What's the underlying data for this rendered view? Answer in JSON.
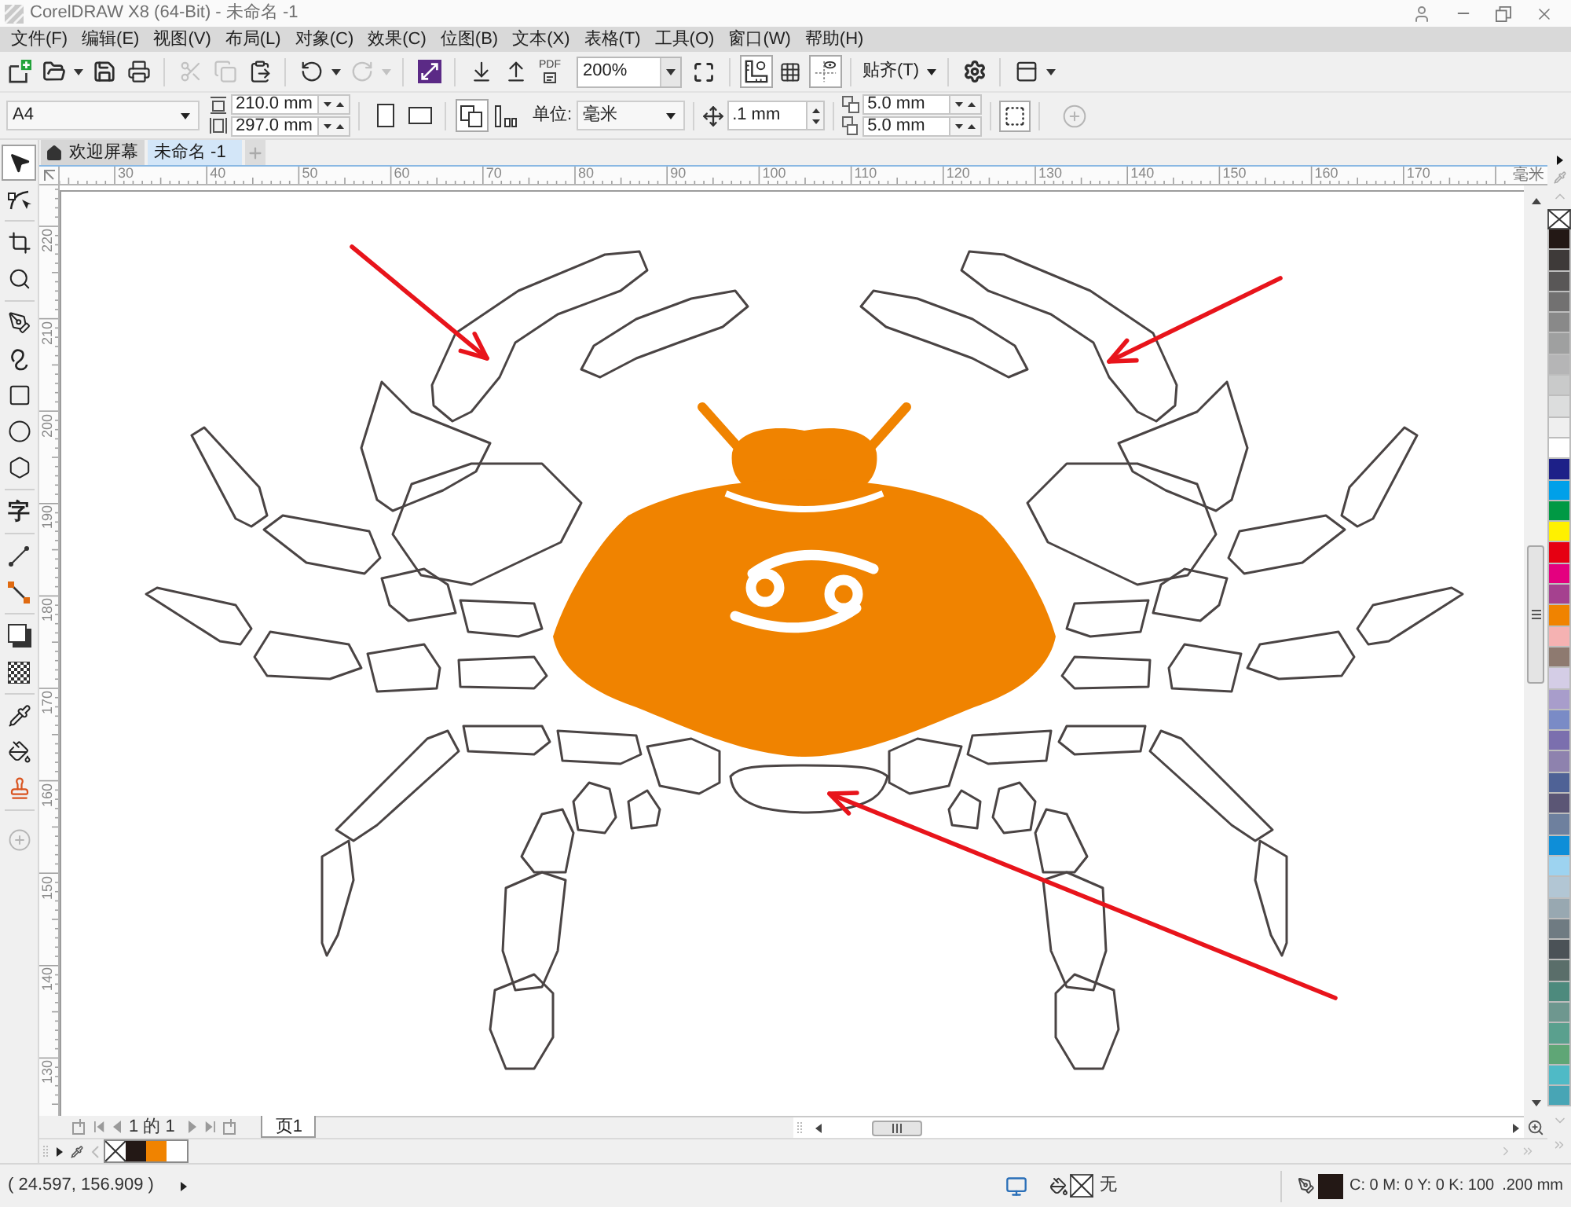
{
  "window": {
    "title": "CorelDRAW X8 (64-Bit) - 未命名 -1"
  },
  "menu": [
    "文件(F)",
    "编辑(E)",
    "视图(V)",
    "布局(L)",
    "对象(C)",
    "效果(C)",
    "位图(B)",
    "文本(X)",
    "表格(T)",
    "工具(O)",
    "窗口(W)",
    "帮助(H)"
  ],
  "standard_toolbar": {
    "buttons": [
      {
        "kind": "new",
        "disabled": false
      },
      {
        "kind": "open",
        "disabled": false
      },
      {
        "kind": "save",
        "disabled": false
      },
      {
        "kind": "print",
        "disabled": false
      },
      {
        "kind": "cut",
        "disabled": true
      },
      {
        "kind": "copy",
        "disabled": true
      },
      {
        "kind": "paste",
        "disabled": false
      },
      {
        "kind": "undo",
        "disabled": false
      },
      {
        "kind": "redo",
        "disabled": true
      },
      {
        "kind": "launcher",
        "disabled": false
      },
      {
        "kind": "import",
        "disabled": false
      },
      {
        "kind": "export",
        "disabled": false
      },
      {
        "kind": "publish_pdf",
        "disabled": false,
        "label": "PDF"
      }
    ],
    "zoom": "200%",
    "view_toggles": [
      {
        "kind": "rulers",
        "on": true
      },
      {
        "kind": "grid",
        "on": false
      },
      {
        "kind": "guidelines",
        "on": true
      }
    ],
    "snap": "贴齐(T)"
  },
  "property_bar": {
    "page_size": "A4",
    "width": "210.0 mm",
    "height": "297.0 mm",
    "page_layout_buttons": [
      {
        "kind": "all_pages",
        "selected": true
      },
      {
        "kind": "current_page",
        "selected": false
      }
    ],
    "units_label": "单位:",
    "units": "毫米",
    "nudge": ".1 mm",
    "duplicate_x": "5.0 mm",
    "duplicate_y": "5.0 mm"
  },
  "toolbox": [
    {
      "kind": "pick",
      "selected": true
    },
    {
      "kind": "shape",
      "selected": false
    },
    {
      "kind": "crop",
      "selected": false
    },
    {
      "kind": "zoom",
      "selected": false
    },
    {
      "kind": "freehand",
      "selected": false
    },
    {
      "kind": "artistic_media",
      "selected": false
    },
    {
      "kind": "rectangle",
      "selected": false
    },
    {
      "kind": "ellipse",
      "selected": false
    },
    {
      "kind": "polygon",
      "selected": false
    },
    {
      "kind": "text",
      "label": "字",
      "selected": false
    },
    {
      "kind": "dimension",
      "selected": false
    },
    {
      "kind": "connector",
      "selected": false
    },
    {
      "kind": "drop_shadow",
      "selected": false
    },
    {
      "kind": "transparency",
      "selected": false
    },
    {
      "kind": "eyedropper",
      "selected": false
    },
    {
      "kind": "interactive_fill",
      "selected": false
    },
    {
      "kind": "smart_fill",
      "selected": false
    }
  ],
  "document_tabs": [
    {
      "kind": "home",
      "label": "欢迎屏幕",
      "selected": false
    },
    {
      "kind": "document",
      "label": "未命名 -1",
      "selected": true
    }
  ],
  "rulers": {
    "unit": "毫米",
    "horizontal": [
      "30",
      "40",
      "50",
      "60",
      "70",
      "80",
      "90",
      "100",
      "110",
      "120",
      "130",
      "140",
      "150",
      "160",
      "170"
    ],
    "vertical": [
      "220",
      "210",
      "200",
      "190",
      "180",
      "170",
      "160",
      "150",
      "140",
      "130"
    ]
  },
  "page_navigation": {
    "position": "1 的 1",
    "pages": [
      {
        "label": "页1",
        "selected": true
      }
    ]
  },
  "document_palette": [
    {
      "color": "#231815"
    },
    {
      "color": "#f08300"
    },
    {
      "color": "#ffffff"
    }
  ],
  "color_palette": [
    {
      "color": "#231815"
    },
    {
      "color": "#3e3a39"
    },
    {
      "color": "#595757"
    },
    {
      "color": "#727171"
    },
    {
      "color": "#898989"
    },
    {
      "color": "#9fa0a0"
    },
    {
      "color": "#b5b5b6"
    },
    {
      "color": "#c9caca"
    },
    {
      "color": "#dcdddd"
    },
    {
      "color": "#efefef"
    },
    {
      "color": "#ffffff"
    },
    {
      "color": "#1d2088"
    },
    {
      "color": "#00a0e9"
    },
    {
      "color": "#009944"
    },
    {
      "color": "#fff100"
    },
    {
      "color": "#e60012"
    },
    {
      "color": "#e4007f"
    },
    {
      "color": "#a5418f"
    },
    {
      "color": "#f08300"
    },
    {
      "color": "#f5b2b2"
    },
    {
      "color": "#8e7a70"
    },
    {
      "color": "#d4cde6"
    },
    {
      "color": "#a89dcb"
    },
    {
      "color": "#7a8bc6"
    },
    {
      "color": "#7b6fae"
    },
    {
      "color": "#8e82ae"
    },
    {
      "color": "#4f6296"
    },
    {
      "color": "#5b5675"
    },
    {
      "color": "#6e809e"
    },
    {
      "color": "#0e8ed8"
    },
    {
      "color": "#9dd3f0"
    },
    {
      "color": "#b2c6d4"
    },
    {
      "color": "#98a8b1"
    },
    {
      "color": "#6f7b82"
    },
    {
      "color": "#4b5257"
    },
    {
      "color": "#5a6e6a"
    },
    {
      "color": "#4d8a7d"
    },
    {
      "color": "#6e978f"
    },
    {
      "color": "#5aa08e"
    },
    {
      "color": "#5fa676"
    },
    {
      "color": "#4fbac6"
    },
    {
      "color": "#48a5b5"
    }
  ],
  "status_bar": {
    "coordinates": "( 24.597, 156.909 )",
    "fill_label": "无",
    "outline": {
      "color": "#231815",
      "values": "C: 0 M: 0 Y: 0 K: 100",
      "width": ".200 mm"
    }
  }
}
